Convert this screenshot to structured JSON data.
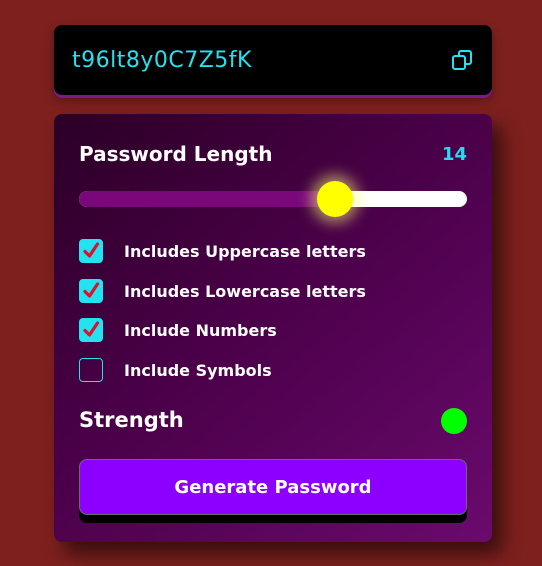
{
  "password": {
    "value": "t96lt8y0C7Z5fK",
    "copy_icon": "copy-icon"
  },
  "length": {
    "label": "Password Length",
    "value": "14",
    "slider_fraction": 0.66
  },
  "options": [
    {
      "label": "Includes Uppercase letters",
      "checked": true
    },
    {
      "label": "Includes Lowercase letters",
      "checked": true
    },
    {
      "label": "Include Numbers",
      "checked": true
    },
    {
      "label": "Include Symbols",
      "checked": false
    }
  ],
  "strength": {
    "label": "Strength",
    "indicator_color": "#00ff00"
  },
  "generate_button": {
    "label": "Generate Password"
  },
  "colors": {
    "accent": "#22e3ef",
    "button": "#8c00ff",
    "thumb": "#ffff00",
    "background": "#7d201e"
  }
}
